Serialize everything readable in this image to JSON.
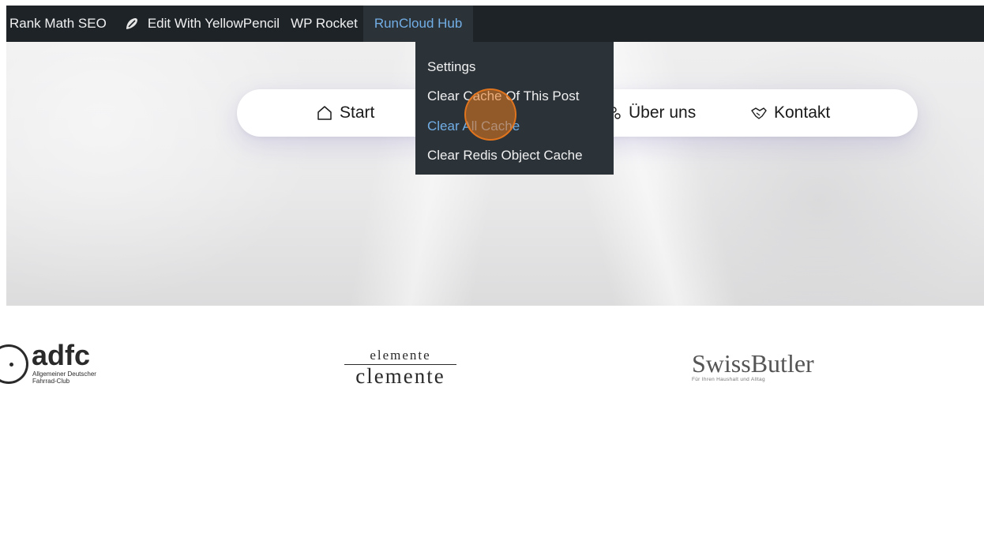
{
  "admin_bar": {
    "items": [
      {
        "label": "Rank Math SEO"
      },
      {
        "label": "Edit With YellowPencil",
        "icon": "yellowpencil-icon"
      },
      {
        "label": "WP Rocket"
      },
      {
        "label": "RunCloud Hub",
        "active": true
      }
    ],
    "colors": {
      "background": "#1d2327",
      "active_bg": "#2c3338",
      "active_text": "#72aee6",
      "text": "#f0f0f1"
    }
  },
  "dropdown": {
    "items": [
      {
        "label": "Settings"
      },
      {
        "label": "Clear Cache Of This Post"
      },
      {
        "label": "Clear All Cache",
        "highlighted": true
      },
      {
        "label": "Clear Redis Object Cache"
      }
    ]
  },
  "nav": {
    "links": [
      {
        "label": "Start",
        "icon": "home-icon"
      },
      {
        "label": "Über uns",
        "icon": "people-icon"
      },
      {
        "label": "Kontakt",
        "icon": "handshake-icon"
      }
    ]
  },
  "logos": {
    "adfc": {
      "word": "adfc",
      "line1": "Allgemeiner Deutscher",
      "line2": "Fahrrad-Club"
    },
    "clemente": {
      "top": "elemente",
      "bottom": "clemente"
    },
    "swissbutler": {
      "word": "SwissButler",
      "tagline": "Für Ihren Haushalt und Alltag"
    }
  },
  "click_marker": {
    "color": "#e8781e"
  }
}
